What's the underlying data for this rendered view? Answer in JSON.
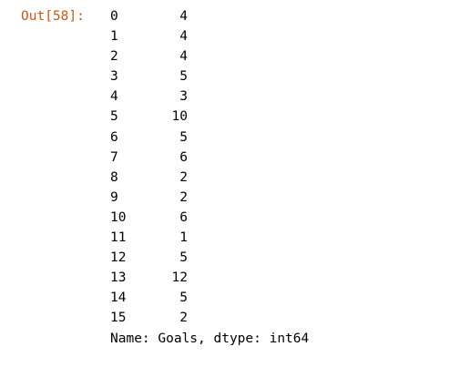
{
  "prompt": "Out[58]:",
  "series": {
    "rows": [
      {
        "index": "0",
        "value": "4"
      },
      {
        "index": "1",
        "value": "4"
      },
      {
        "index": "2",
        "value": "4"
      },
      {
        "index": "3",
        "value": "5"
      },
      {
        "index": "4",
        "value": "3"
      },
      {
        "index": "5",
        "value": "10"
      },
      {
        "index": "6",
        "value": "5"
      },
      {
        "index": "7",
        "value": "6"
      },
      {
        "index": "8",
        "value": "2"
      },
      {
        "index": "9",
        "value": "2"
      },
      {
        "index": "10",
        "value": "6"
      },
      {
        "index": "11",
        "value": "1"
      },
      {
        "index": "12",
        "value": "5"
      },
      {
        "index": "13",
        "value": "12"
      },
      {
        "index": "14",
        "value": "5"
      },
      {
        "index": "15",
        "value": "2"
      }
    ],
    "footer": "Name: Goals, dtype: int64"
  },
  "colors": {
    "prompt": "#c25a1c",
    "text": "#000000",
    "background": "#ffffff"
  }
}
